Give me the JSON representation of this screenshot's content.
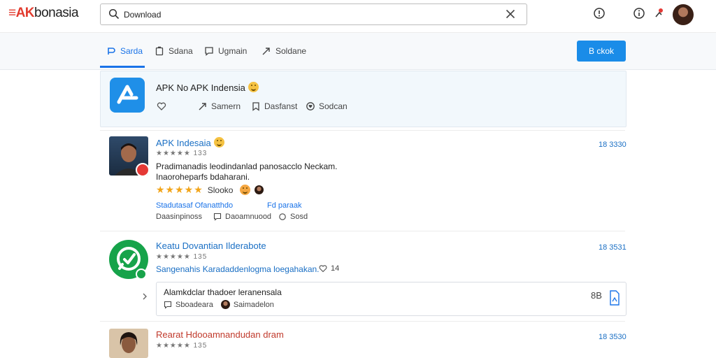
{
  "header": {
    "logo_prefix": "≡AK",
    "logo_suffix": "bonasia",
    "search_value": "Download"
  },
  "tabs": [
    {
      "label": "Sarda",
      "active": true
    },
    {
      "label": "Sdana",
      "active": false
    },
    {
      "label": "Ugmain",
      "active": false
    },
    {
      "label": "Soldane",
      "active": false
    }
  ],
  "primary_button": "B ckok",
  "featured": {
    "title": "APK No APK Indensia",
    "actions": [
      "Samern",
      "Dasfanst",
      "Sodcan"
    ]
  },
  "list": [
    {
      "name": "APK Indesaia",
      "rating_text": "★★★★★ 133",
      "date": "18 3330",
      "desc_line1": "Pradimanadis leodindanlad panosacclo Neckam.",
      "desc_line2": "Inaoroheparfs bdaharani.",
      "stars_text": "★★★★★",
      "stars_label": "Slooko",
      "links": [
        "Stadutasaf Ofanatthdo",
        "Fd paraak"
      ],
      "meta": [
        "Daasinpinoss",
        "Daoamnuood",
        "Sosd"
      ]
    },
    {
      "name": "Keatu Dovantian Ilderabote",
      "rating_text": "★★★★★ 135",
      "date": "18 3531",
      "desc_line1": "Sangenahis Karadaddenlogma loegahakan.",
      "counter": "14",
      "subcard": {
        "title": "Alamkdclar thadoer leranensala",
        "meta": "Sboadeara",
        "author": "Saimadelon",
        "end_label": "8B"
      }
    },
    {
      "name": "Rearat Hdooamnandudan dram",
      "rating_text": "★★★★★ 135",
      "date": "18 3530"
    }
  ],
  "colors": {
    "accent": "#1a73e8",
    "button": "#1a8ce8",
    "logo_red": "#e23b2e",
    "star": "#f2a51a"
  }
}
